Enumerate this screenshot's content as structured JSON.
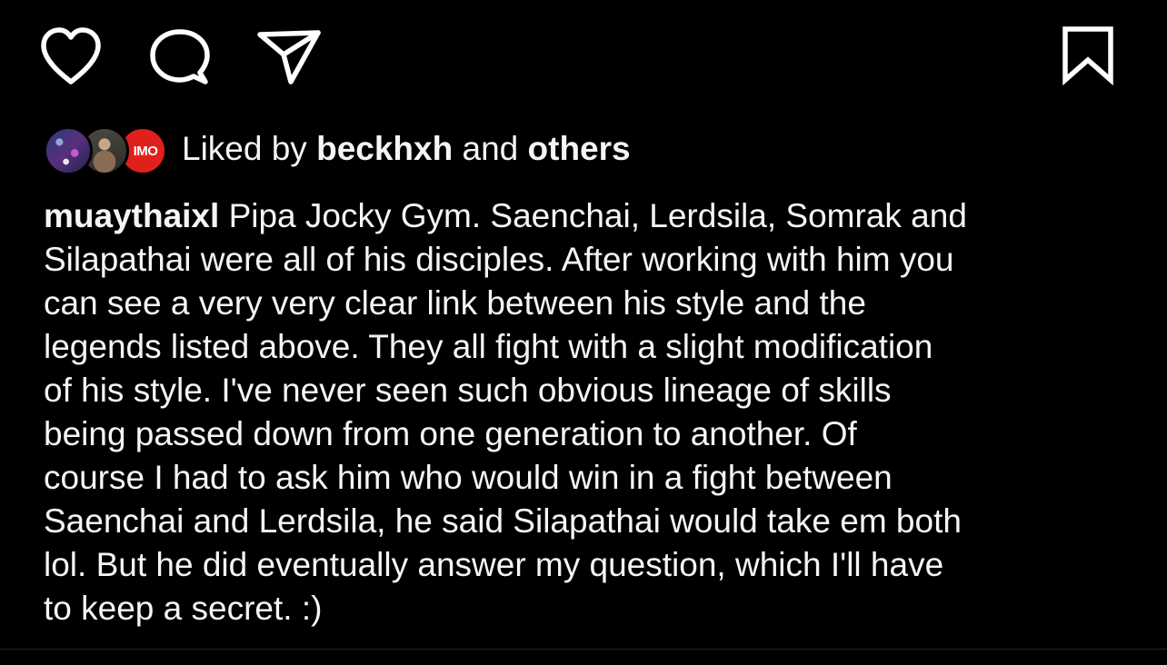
{
  "actions": {
    "like_icon": "heart-icon",
    "comment_icon": "comment-icon",
    "share_icon": "paper-plane-icon",
    "save_icon": "bookmark-icon"
  },
  "likes": {
    "prefix": "Liked by ",
    "user": "beckhxh",
    "middle": " and ",
    "others": "others",
    "avatar_3_text": "IMO"
  },
  "caption": {
    "username": "muaythaixl",
    "lines": [
      " Pipa Jocky Gym. Saenchai, Lerdsila, Somrak and",
      "Silapathai were all of his disciples. After working with him you",
      "can see a very very clear link between his style and the",
      "legends listed above. They all fight with a slight modification",
      "of his style. I've never seen such obvious lineage of skills",
      "being passed down from one generation to another. Of",
      "course I had to ask him who would win in a fight between",
      "Saenchai and Lerdsila, he said Silapathai would take em both",
      "lol. But he did eventually answer my question, which I'll have",
      "to keep a secret. :)"
    ]
  },
  "colors": {
    "background": "#000000",
    "text": "#f5f5f5",
    "accent_avatar": "#e0201b"
  }
}
